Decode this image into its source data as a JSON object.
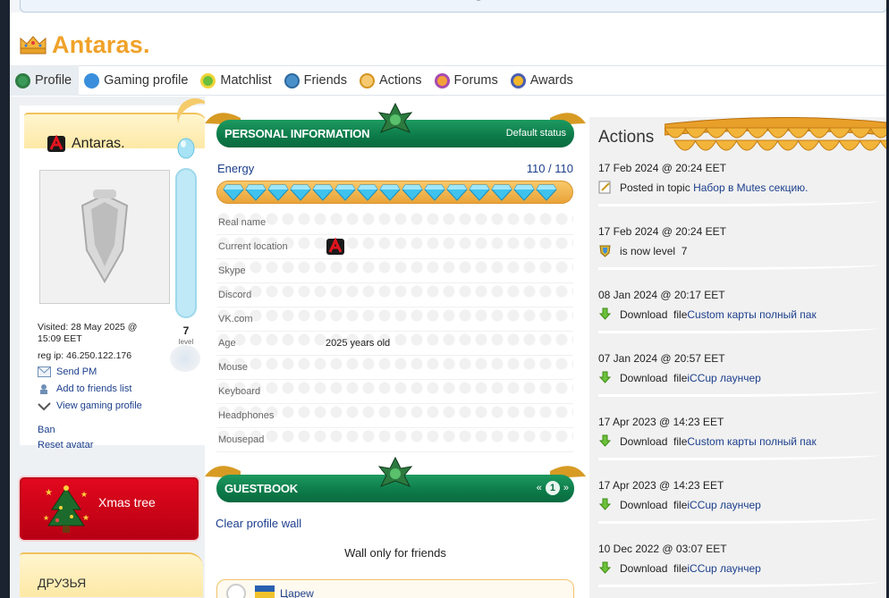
{
  "page": {
    "title": "Antaras.",
    "colors": {
      "accent": "#f0a22a",
      "link": "#1c3f8c",
      "banner_green": "#0c7a49",
      "xmas_red": "#d30018"
    }
  },
  "tabs": [
    {
      "label": "Profile",
      "icon": "profile-icon",
      "active": true
    },
    {
      "label": "Gaming profile",
      "icon": "info-icon",
      "active": false
    },
    {
      "label": "Matchlist",
      "icon": "matchlist-icon",
      "active": false
    },
    {
      "label": "Friends",
      "icon": "friends-icon",
      "active": false
    },
    {
      "label": "Actions",
      "icon": "actions-icon",
      "active": false
    },
    {
      "label": "Forums",
      "icon": "forums-icon",
      "active": false
    },
    {
      "label": "Awards",
      "icon": "awards-icon",
      "active": false
    }
  ],
  "profile_card": {
    "name": "Antaras.",
    "level": "7",
    "level_label": "level",
    "visited": "Visited: 28 May 2025 @ 15:09 EET",
    "reg_ip": "reg ip: 46.250.122.176",
    "send_pm": "Send PM",
    "add_friend": "Add to friends list",
    "view_gaming": "View gaming profile",
    "ban": "Ban",
    "reset_avatar": "Reset avatar"
  },
  "xmas_tree": {
    "label": "Xmas tree"
  },
  "friends_box": {
    "label": "ДРУЗЬЯ"
  },
  "personal_info": {
    "title": "PERSONAL INFORMATION",
    "status": "Default status",
    "energy_label": "Energy",
    "energy_value": "110 / 110",
    "energy_fraction": 1.0,
    "rows": [
      {
        "label": "Real name",
        "value": ""
      },
      {
        "label": "Current location",
        "value": ""
      },
      {
        "label": "Skype",
        "value": ""
      },
      {
        "label": "Discord",
        "value": ""
      },
      {
        "label": "VK.com",
        "value": ""
      },
      {
        "label": "Age",
        "value": "2025 years old"
      },
      {
        "label": "Mouse",
        "value": ""
      },
      {
        "label": "Keyboard",
        "value": ""
      },
      {
        "label": "Headphones",
        "value": ""
      },
      {
        "label": "Mousepad",
        "value": ""
      }
    ]
  },
  "guestbook": {
    "title": "GUESTBOOK",
    "prev": "«",
    "page": "1",
    "next": "»",
    "clear_wall": "Clear profile wall",
    "wall_only": "Wall only for friends",
    "first_entry_name": "Цареw"
  },
  "actions": {
    "title": "Actions",
    "items": [
      {
        "date": "17 Feb 2024 @ 20:24 EET",
        "icon": "edit-icon",
        "text": "Posted in topic ",
        "link": "Набор в Mutes секцию."
      },
      {
        "date": "17 Feb 2024 @ 20:24 EET",
        "icon": "level-shield-icon",
        "text": "is now level  7",
        "link": ""
      },
      {
        "date": "08 Jan 2024 @ 20:17 EET",
        "icon": "download-icon",
        "text": "Download  file",
        "link": "Custom карты полный пак"
      },
      {
        "date": "07 Jan 2024 @ 20:57 EET",
        "icon": "download-icon",
        "text": "Download  file",
        "link": "iCCup лаунчер"
      },
      {
        "date": "17 Apr 2023 @ 14:23 EET",
        "icon": "download-icon",
        "text": "Download  file",
        "link": "Custom карты полный пак"
      },
      {
        "date": "17 Apr 2023 @ 14:23 EET",
        "icon": "download-icon",
        "text": "Download  file",
        "link": "iCCup лаунчер"
      },
      {
        "date": "10 Dec 2022 @ 03:07 EET",
        "icon": "download-icon",
        "text": "Download  file",
        "link": "iCCup лаунчер"
      }
    ]
  }
}
